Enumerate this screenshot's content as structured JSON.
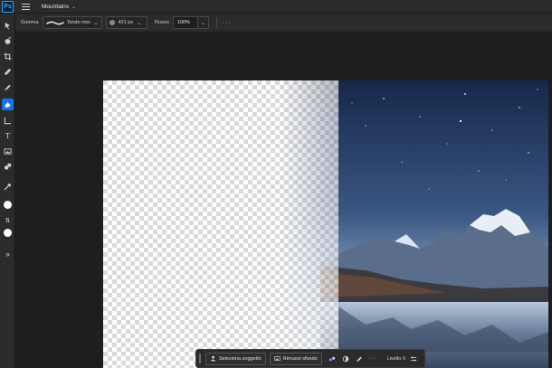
{
  "app": {
    "logo": "Ps",
    "document_title": "Mountains"
  },
  "options": {
    "brush_label": "Gomma",
    "brush_name": "Tondo mor...",
    "size_value": "421 px",
    "flow_label": "Flusso",
    "flow_value": "100%",
    "more": "···"
  },
  "toolbar": {
    "tools": [
      "move-icon",
      "quick-select-icon",
      "crop-icon",
      "healing-icon",
      "clone-stamp-icon",
      "eraser-icon",
      "ruler-icon",
      "type-icon",
      "image-icon",
      "shape-icon",
      "eyedropper-icon"
    ],
    "active_tool": "eraser-icon",
    "type_glyph": "T",
    "foreground_color": "#ffffff",
    "background_color": "#ffffff",
    "swap_glyph": "⇅",
    "expand_glyph": "»"
  },
  "taskbar": {
    "select_subject": "Seleziona soggetto",
    "remove_background": "Rimuovi sfondo",
    "more": "···",
    "layer_label": "Livello 0"
  },
  "colors": {
    "accent": "#1473e6",
    "panel": "#2b2b2b",
    "workspace": "#1e1e1e"
  }
}
